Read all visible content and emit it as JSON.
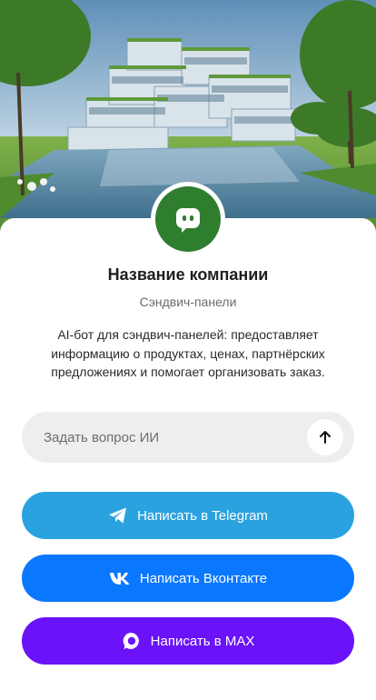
{
  "company": {
    "name": "Название компании",
    "category": "Сэндвич-панели",
    "description": "AI-бот для сэндвич-панелей: предоставляет информацию о продуктах, ценах, партнёрских предложениях и помогает организовать заказ."
  },
  "ask": {
    "placeholder": "Задать вопрос ИИ"
  },
  "buttons": {
    "telegram": "Написать в Telegram",
    "vk": "Написать Вконтакте",
    "max": "Написать в MAX"
  },
  "icons": {
    "hero": "modern-office-building-image",
    "avatar": "chat-bot-icon",
    "send": "arrow-up-icon",
    "telegram": "telegram-icon",
    "vk": "vk-icon",
    "max": "max-icon"
  },
  "colors": {
    "avatar": "#2f7d2f",
    "telegram": "#2ba2e0",
    "vk": "#0a77ff",
    "max": "#6a12f8"
  }
}
